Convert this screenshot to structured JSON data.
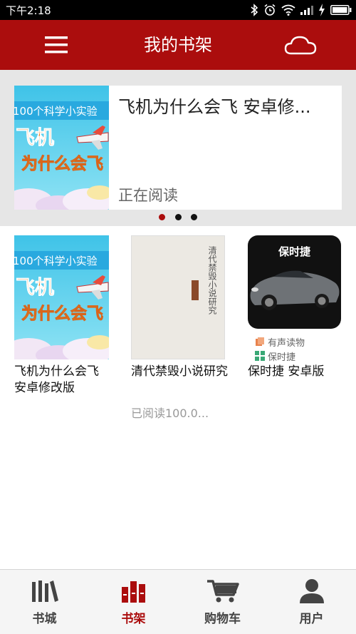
{
  "status_bar": {
    "time": "下午2:18"
  },
  "app_bar": {
    "title": "我的书架",
    "menu_icon": "menu-icon",
    "cloud_icon": "cloud-icon"
  },
  "banner": {
    "title": "飞机为什么会飞 安卓修...",
    "status": "正在阅读",
    "cover": {
      "header": "100个科学小实验",
      "line1": "飞机",
      "line2": "为什么会飞"
    },
    "dots_count": 3,
    "active_dot": 0
  },
  "shelf": [
    {
      "title": "飞机为什么会飞 安卓修改版",
      "cover": {
        "header": "100个科学小实验",
        "line1": "飞机",
        "line2": "为什么会飞"
      }
    },
    {
      "title": "清代禁毁小说研究",
      "progress": "已阅读100.0...",
      "cover": {
        "title_vertical": "清代禁毁小说研究"
      }
    },
    {
      "title": "保时捷 安卓版",
      "cover": {
        "title": "保时捷"
      },
      "tags": [
        {
          "icon": "audiobook-icon",
          "label": "有声读物",
          "color": "#e8824c"
        },
        {
          "icon": "app-icon",
          "label": "保时捷",
          "color": "#3aa876"
        }
      ]
    }
  ],
  "bottom_nav": [
    {
      "label": "书城",
      "icon": "bookstore-icon",
      "active": false
    },
    {
      "label": "书架",
      "icon": "bookshelf-icon",
      "active": true
    },
    {
      "label": "购物车",
      "icon": "cart-icon",
      "active": false
    },
    {
      "label": "用户",
      "icon": "user-icon",
      "active": false
    }
  ],
  "colors": {
    "primary": "#ab0d0d",
    "active_dot": "#ab0d0d",
    "banner_bg": "#e6e6e6"
  }
}
